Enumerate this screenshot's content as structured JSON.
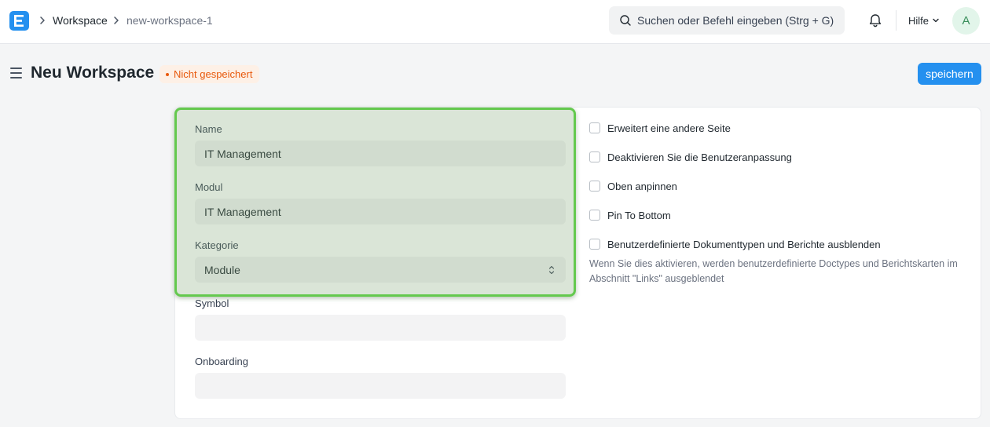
{
  "navbar": {
    "logo_letter": "E",
    "breadcrumbs": [
      "Workspace",
      "new-workspace-1"
    ],
    "search_placeholder": "Suchen oder Befehl eingeben (Strg + G)",
    "help_label": "Hilfe",
    "avatar_initial": "A"
  },
  "page": {
    "title": "Neu Workspace",
    "status": "Nicht gespeichert",
    "save_label": "speichern"
  },
  "form": {
    "name_label": "Name",
    "name_value": "IT Management",
    "module_label": "Modul",
    "module_value": "IT Management",
    "category_label": "Kategorie",
    "category_value": "Module",
    "symbol_label": "Symbol",
    "symbol_value": "",
    "onboarding_label": "Onboarding",
    "onboarding_value": "",
    "checkboxes": [
      "Erweitert eine andere Seite",
      "Deaktivieren Sie die Benutzeranpassung",
      "Oben anpinnen",
      "Pin To Bottom",
      "Benutzerdefinierte Dokumenttypen und Berichte ausblenden"
    ],
    "hide_custom_help": "Wenn Sie dies aktivieren, werden benutzerdefinierte Doctypes und Berichtskarten im Abschnitt \"Links\" ausgeblendet"
  },
  "colors": {
    "accent": "#2490ef",
    "status": "#e8590c",
    "highlight": "#64c94e"
  }
}
